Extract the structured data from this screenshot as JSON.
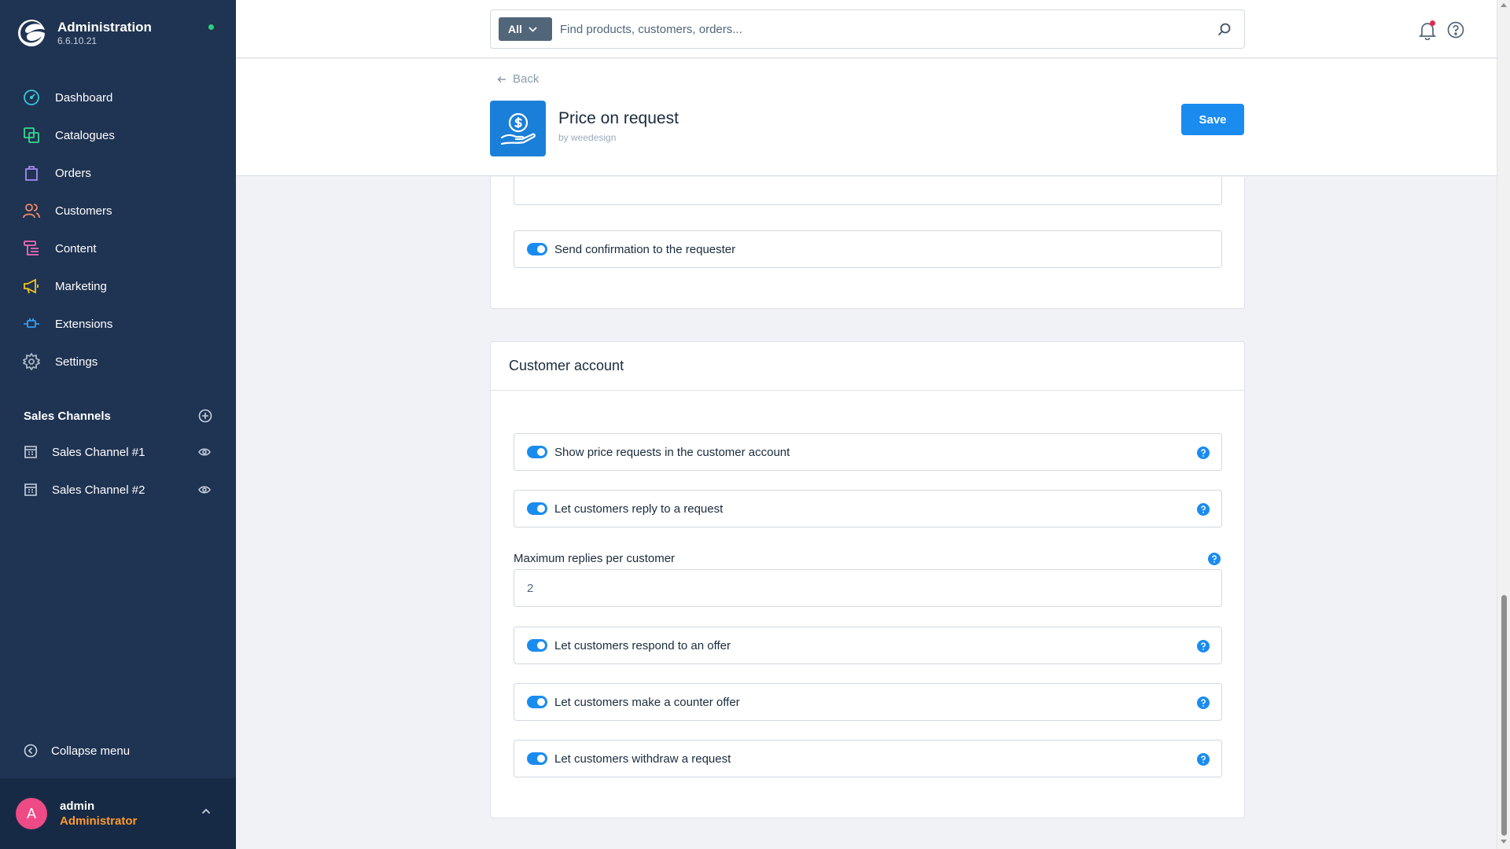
{
  "brand": {
    "title": "Administration",
    "version": "6.6.10.21"
  },
  "nav": [
    {
      "label": "Dashboard",
      "icon": "dashboard-icon",
      "color": "#37c6d9"
    },
    {
      "label": "Catalogues",
      "icon": "catalogues-icon",
      "color": "#37d98c"
    },
    {
      "label": "Orders",
      "icon": "orders-icon",
      "color": "#a38bf0"
    },
    {
      "label": "Customers",
      "icon": "customers-icon",
      "color": "#f08b6b"
    },
    {
      "label": "Content",
      "icon": "content-icon",
      "color": "#ee6bb9"
    },
    {
      "label": "Marketing",
      "icon": "marketing-icon",
      "color": "#f5c518"
    },
    {
      "label": "Extensions",
      "icon": "extensions-icon",
      "color": "#3a9cf0"
    },
    {
      "label": "Settings",
      "icon": "settings-icon",
      "color": "#a7b5c4"
    }
  ],
  "sales_channels": {
    "title": "Sales Channels",
    "items": [
      {
        "label": "Sales Channel #1"
      },
      {
        "label": "Sales Channel #2"
      }
    ]
  },
  "collapse_label": "Collapse menu",
  "user": {
    "initial": "A",
    "name": "admin",
    "role": "Administrator"
  },
  "search": {
    "type": "All",
    "placeholder": "Find products, customers, orders..."
  },
  "header": {
    "back_label": "Back",
    "title": "Price on request",
    "author": "by weedesign",
    "save_label": "Save"
  },
  "card1": {
    "confirmation_label": "Send confirmation to the requester"
  },
  "card2": {
    "title": "Customer account",
    "fields": [
      {
        "label": "Show price requests in the customer account",
        "enabled": true
      },
      {
        "label": "Let customers reply to a request",
        "enabled": true
      }
    ],
    "max_replies": {
      "label": "Maximum replies per customer",
      "value": "2"
    },
    "fields2": [
      {
        "label": "Let customers respond to an offer",
        "enabled": true
      },
      {
        "label": "Let customers make a counter offer",
        "enabled": true
      },
      {
        "label": "Let customers withdraw a request",
        "enabled": true
      }
    ]
  },
  "colors": {
    "sidebar": "#1f3352",
    "accent": "#1a8cf0",
    "role": "#ff9a2e",
    "avatar": "#ee4b86"
  }
}
